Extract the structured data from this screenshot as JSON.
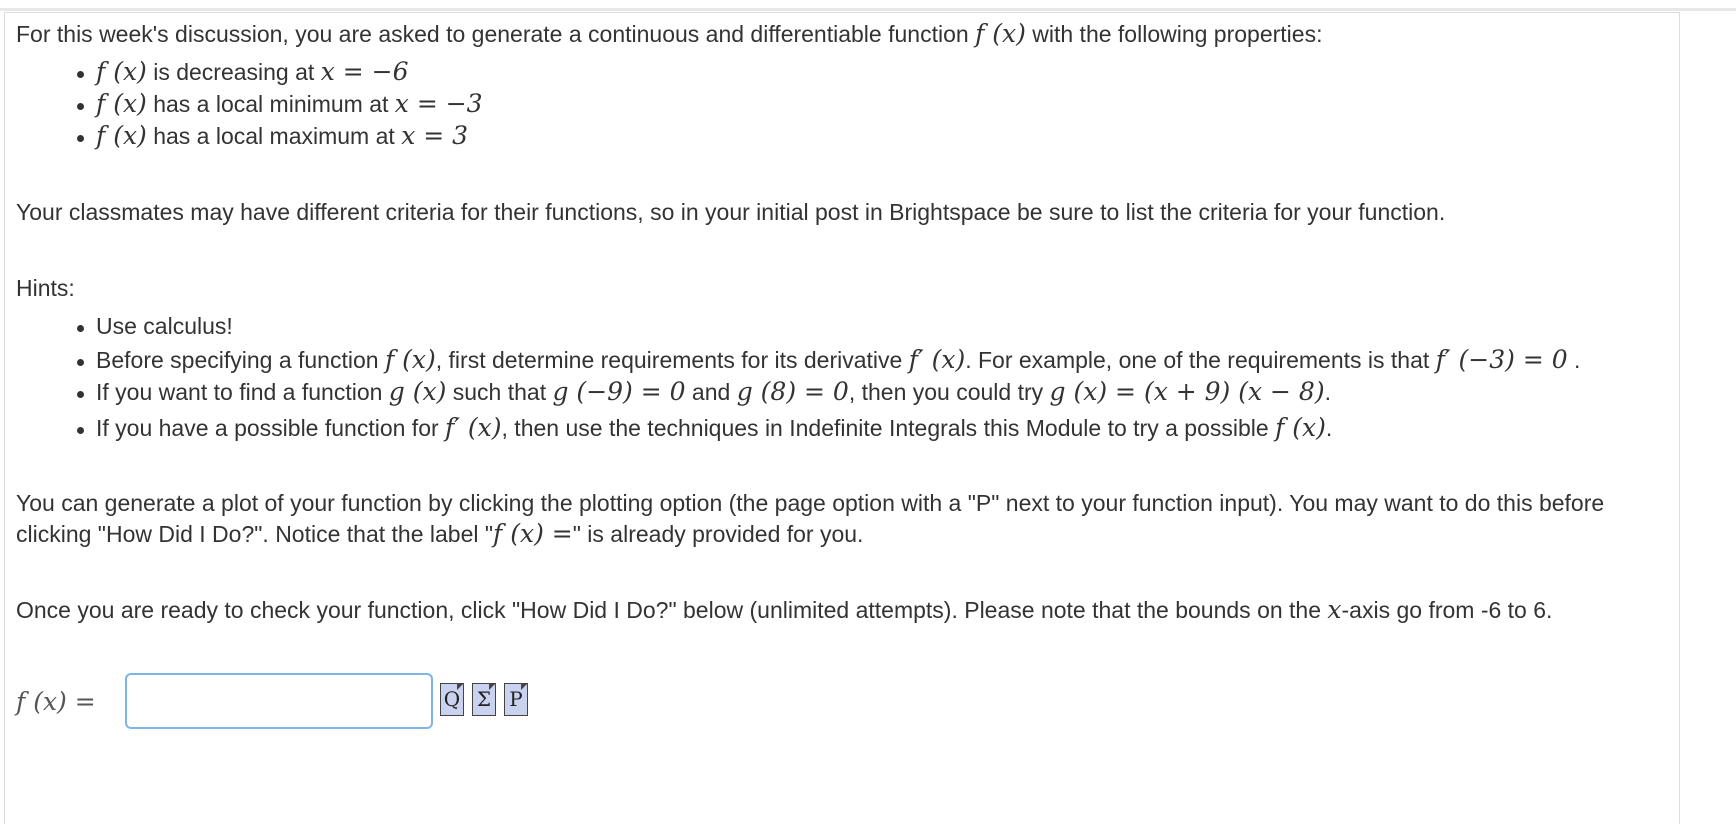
{
  "intro": {
    "pre": "For this week's discussion, you are asked to generate a continuous and differentiable function ",
    "fx": "f (x)",
    "post": " with the following properties:"
  },
  "properties": [
    {
      "fx": "f (x)",
      "text": " is decreasing at ",
      "math": "x = −6"
    },
    {
      "fx": "f (x)",
      "text": " has a local minimum at ",
      "math": "x = −3"
    },
    {
      "fx": "f (x)",
      "text": " has a local maximum at ",
      "math": "x = 3"
    }
  ],
  "criteria_note": "Your classmates may have different criteria for their functions, so in your initial post in Brightspace be sure to list the criteria for your function.",
  "hints_label": "Hints:",
  "hints": {
    "h1": "Use calculus!",
    "h2": {
      "a": "Before specifying a function ",
      "b": "f (x)",
      "c": ", first determine requirements for its derivative ",
      "d": "f′ (x)",
      "e": ". For example, one of the requirements is that ",
      "f": "f′ (−3) = 0",
      "g": " ."
    },
    "h3": {
      "a": "If you want to find a function ",
      "b": "g (x)",
      "c": " such that ",
      "d": "g (−9) = 0",
      "e": " and ",
      "f": "g (8) = 0",
      "g": ", then you could try ",
      "h": "g (x) = (x + 9) (x − 8)",
      "i": "."
    },
    "h4": {
      "a": "If you have a possible function for ",
      "b": "f′ (x)",
      "c": ", then use the techniques in Indefinite Integrals this Module to try a possible ",
      "d": "f (x)",
      "e": "."
    }
  },
  "plot_note": {
    "line1": "You can generate a plot of your function by clicking the plotting option (the page option with a \"P\" next to your function input). You may want to do this before",
    "line2_a": "clicking \"How Did I Do?\". Notice that the label \"",
    "line2_b": "f (x) =",
    "line2_c": "\" is already provided for you."
  },
  "check_note": {
    "a": "Once you are ready to check your function, click \"How Did I Do?\" below (unlimited attempts). Please note that the bounds on the ",
    "b": "x",
    "c": "-axis go from -6 to 6."
  },
  "answer": {
    "label": "f (x) =",
    "value": "",
    "tools": [
      {
        "icon": "preview-icon",
        "glyph": "Q"
      },
      {
        "icon": "equation-editor-icon",
        "glyph": "Σ"
      },
      {
        "icon": "plot-icon",
        "glyph": "P"
      }
    ]
  }
}
